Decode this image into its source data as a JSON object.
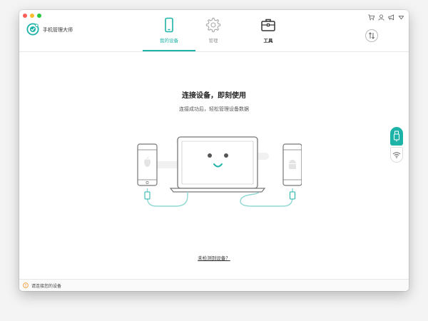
{
  "app": {
    "title": "手机管理大师"
  },
  "tabs": [
    {
      "label": "我的设备",
      "icon": "phone-icon",
      "active": true
    },
    {
      "label": "管理",
      "icon": "gear-icon",
      "active": false
    },
    {
      "label": "工具",
      "icon": "toolbox-icon",
      "active": false
    }
  ],
  "top_icons": [
    "cart-icon",
    "user-icon",
    "megaphone-icon",
    "dropdown-icon"
  ],
  "main": {
    "headline": "连接设备，即刻使用",
    "subline": "连接成功后，轻松管理设备数据",
    "no_device_link": "未检测到设备？"
  },
  "side_buttons": [
    "usb-icon",
    "wifi-icon"
  ],
  "status": {
    "text": "请连接您的设备",
    "icon": "warning-icon"
  },
  "colors": {
    "accent": "#1db3a8",
    "warning": "#f29a38"
  }
}
